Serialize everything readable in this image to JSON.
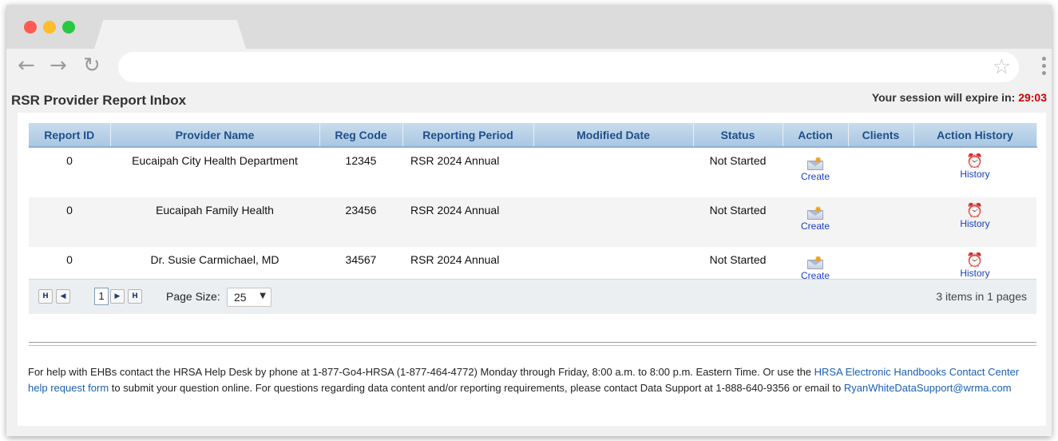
{
  "page": {
    "title": "RSR Provider Report Inbox",
    "session_label": "Your session will expire in:",
    "session_time": "29:03"
  },
  "grid": {
    "columns": [
      "Report ID",
      "Provider Name",
      "Reg Code",
      "Reporting Period",
      "Modified Date",
      "Status",
      "Action",
      "Clients",
      "Action History"
    ],
    "rows": [
      {
        "report_id": "0",
        "provider": "Eucaipah City Health Department",
        "reg_code": "12345",
        "period": "RSR 2024 Annual",
        "modified": "",
        "status": "Not Started",
        "action": "Create",
        "clients": "",
        "history": "History"
      },
      {
        "report_id": "0",
        "provider": "Eucaipah Family Health",
        "reg_code": "23456",
        "period": "RSR 2024 Annual",
        "modified": "",
        "status": "Not Started",
        "action": "Create",
        "clients": "",
        "history": "History"
      },
      {
        "report_id": "0",
        "provider": "Dr. Susie Carmichael, MD",
        "reg_code": "34567",
        "period": "RSR 2024 Annual",
        "modified": "",
        "status": "Not Started",
        "action": "Create",
        "clients": "",
        "history": "History"
      }
    ]
  },
  "pager": {
    "first": "H",
    "prev": "◀",
    "current_page": "1",
    "next": "▶",
    "last": "H",
    "page_size_label": "Page Size:",
    "page_size_value": "25",
    "items_info": "3 items in 1 pages"
  },
  "help": {
    "text1": "For help with EHBs contact the HRSA Help Desk by phone at 1-877-Go4-HRSA (1-877-464-4772) Monday through Friday, 8:00 a.m. to 8:00 p.m. Eastern Time. Or use the ",
    "link1": "HRSA Electronic Handbooks Contact Center help request form",
    "text2": " to submit your question online. For questions regarding data content and/or reporting requirements, please contact Data Support at 1-888-640-9356 or email to ",
    "link2": "RyanWhiteDataSupport@wrma.com"
  },
  "icons": {
    "create": "envelope-create-icon",
    "history": "alarm-clock-icon"
  },
  "colors": {
    "header_text": "#1f4e8a",
    "session_time": "#cc0000",
    "link": "#1a5fb4"
  }
}
